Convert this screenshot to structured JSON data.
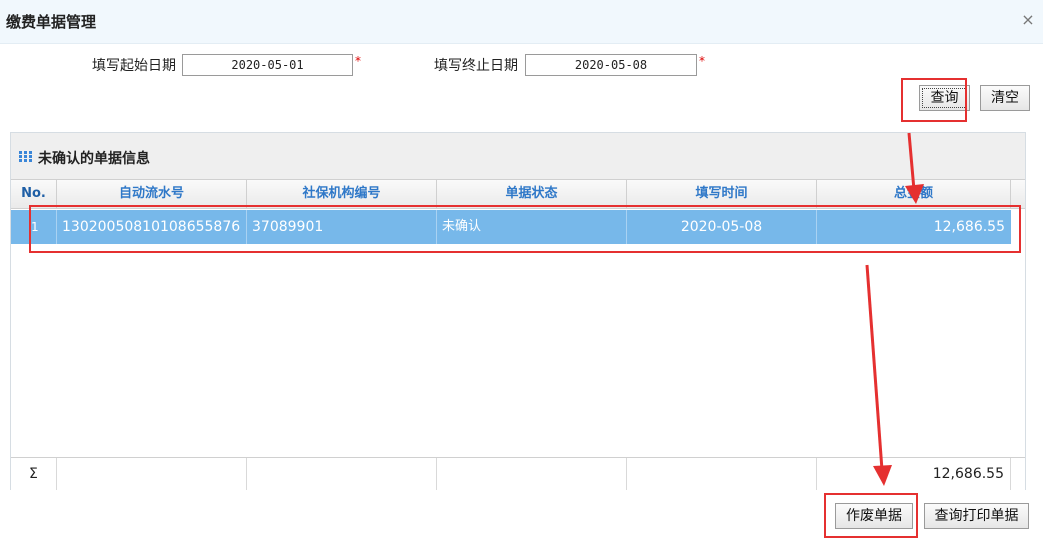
{
  "dialog": {
    "title": "缴费单据管理",
    "close_glyph": "×"
  },
  "filters": {
    "start_label": "填写起始日期",
    "start_value": "2020-05-01",
    "end_label": "填写终止日期",
    "end_value": "2020-05-08",
    "required_mark": "*"
  },
  "buttons": {
    "query": "查询",
    "clear": "清空",
    "void": "作废单据",
    "print_query": "查询打印单据"
  },
  "panel": {
    "title": "未确认的单据信息",
    "icon": "grid-icon"
  },
  "table": {
    "columns": [
      "No.",
      "自动流水号",
      "社保机构编号",
      "单据状态",
      "填写时间",
      "总金额"
    ],
    "rows": [
      {
        "no": "1",
        "serial": "13020050810108655876",
        "agency": "37089901",
        "status": "未确认",
        "date": "2020-05-08",
        "amount": "12,686.55"
      }
    ],
    "footer": {
      "sigma": "Σ",
      "total": "12,686.55"
    }
  },
  "colors": {
    "selected_row": "#77b8ea",
    "header_text": "#2f78c8",
    "annotation_red": "#e53030"
  }
}
